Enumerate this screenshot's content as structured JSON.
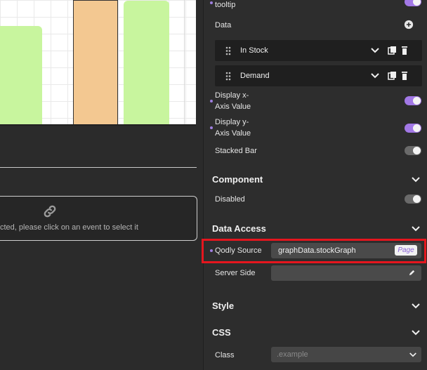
{
  "chart_data": {
    "type": "bar",
    "categories": [],
    "series": [],
    "title": "",
    "xlabel": "",
    "ylabel": ""
  },
  "canvas": {
    "event_message": "cted, please click on an event to select it"
  },
  "panel": {
    "tooltip_label": "tooltip",
    "data_label": "Data",
    "data_items": [
      {
        "name": "In Stock"
      },
      {
        "name": "Demand"
      }
    ],
    "display_x_label_line1": "Display x-",
    "display_x_label_line2": "Axis Value",
    "display_y_label_line1": "Display y-",
    "display_y_label_line2": "Axis Value",
    "stacked_bar_label": "Stacked Bar",
    "component_section": "Component",
    "disabled_label": "Disabled",
    "data_access_section": "Data Access",
    "qodly_source_label": "Qodly Source",
    "qodly_source_value": "graphData.stockGraph",
    "page_badge": "Page",
    "server_side_label": "Server Side",
    "style_section": "Style",
    "css_section": "CSS",
    "class_label": "Class",
    "class_placeholder": ".example"
  },
  "colors": {
    "accent": "#a278e6",
    "highlight": "#e5161e",
    "bar_green": "#c8f59e",
    "bar_orange": "#f3c891"
  }
}
